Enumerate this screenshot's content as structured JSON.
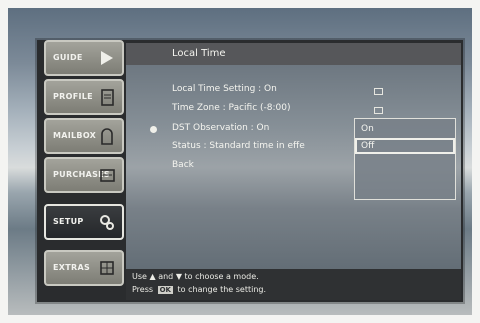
{
  "sidebar": {
    "items": [
      {
        "label": "GUIDE",
        "icon": "arrow-right-icon"
      },
      {
        "label": "PROFILE",
        "icon": "profile-card-icon"
      },
      {
        "label": "MAILBOX",
        "icon": "mailbox-icon"
      },
      {
        "label": "PURCHASES",
        "icon": "purchase-ticket-icon"
      },
      {
        "label": "SETUP",
        "icon": "gears-icon"
      },
      {
        "label": "EXTRAS",
        "icon": "extras-grid-icon"
      }
    ],
    "active_index": 4
  },
  "header": {
    "title": "Local Time"
  },
  "menu": {
    "items": [
      "Local Time Setting : On",
      "Time Zone : Pacific (-8:00)",
      "DST Observation : On",
      "Status : Standard time in effe",
      "Back"
    ],
    "selected_index": 2
  },
  "dropdown": {
    "options": [
      "On",
      "Off"
    ],
    "highlighted": 1
  },
  "help": {
    "line1_a": "Use",
    "line1_b": "and",
    "line1_c": "to choose a mode.",
    "line2_a": "Press",
    "line2_key": "OK",
    "line2_b": "to change the setting."
  },
  "colors": {
    "panel": "#2a2c2e",
    "header": "#56575a",
    "text": "#f5f5f0"
  }
}
